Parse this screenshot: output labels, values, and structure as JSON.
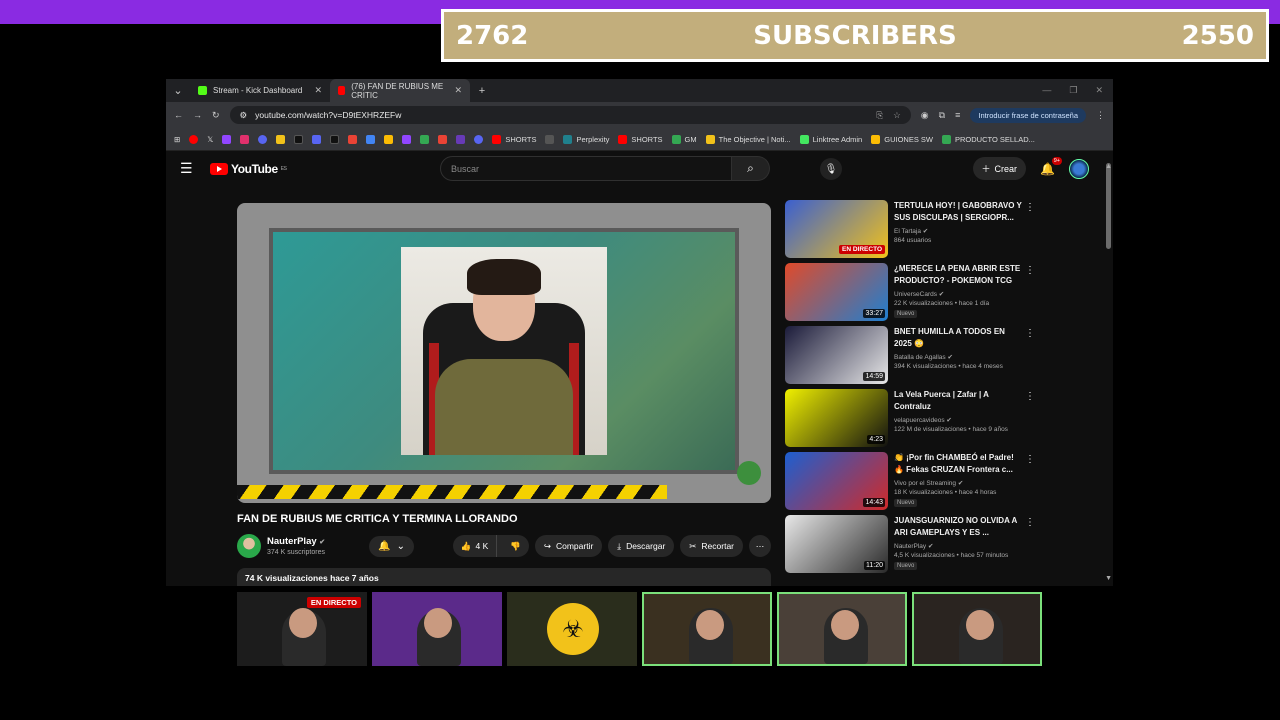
{
  "overlay": {
    "left_count": "2762",
    "label": "SUBSCRIBERS",
    "right_count": "2550"
  },
  "browser": {
    "tabs": [
      {
        "title": "Stream - Kick Dashboard",
        "icon": "kick-icon"
      },
      {
        "title": "(76) FAN DE RUBIUS ME CRITIC",
        "icon": "youtube-icon"
      }
    ],
    "url": "youtube.com/watch?v=D9tEXHRZEFw",
    "password_pill": "Introducir frase de contraseña",
    "bookmarks": [
      "SHORTS",
      "Perplexity",
      "SHORTS",
      "GM",
      "The Objective | Noti...",
      "Linktree Admin",
      "GUIONES SW",
      "PRODUCTO SELLAD..."
    ]
  },
  "youtube": {
    "logo_text": "YouTube",
    "logo_region": "ES",
    "search_placeholder": "Buscar",
    "create_label": "Crear",
    "notif_badge": "9+",
    "video": {
      "title": "FAN DE RUBIUS ME CRITICA Y TERMINA LLORANDO",
      "channel": "NauterPlay",
      "subscribers": "374 K suscriptores",
      "likes": "4 K",
      "share": "Compartir",
      "download": "Descargar",
      "clip": "Recortar",
      "views": "74 K visualizaciones",
      "age": "hace 7 años"
    },
    "recommendations": [
      {
        "title": "TERTULIA HOY! | GABOBRAVO Y SUS DISCULPAS | SERGIOPR...",
        "channel": "El Tartaja",
        "meta": "864 usuarios",
        "badge_live": "EN DIRECTO",
        "duration": "",
        "new": "",
        "colors": [
          "#3a5fd0",
          "#f2c21a"
        ]
      },
      {
        "title": "¿MERECE LA PENA ABRIR ESTE PRODUCTO? - POKEMON TCG",
        "channel": "UniverseCards",
        "meta": "22 K visualizaciones • hace 1 día",
        "badge_live": "",
        "duration": "33:27",
        "new": "Nuevo",
        "colors": [
          "#e04a2a",
          "#1f7fd0"
        ]
      },
      {
        "title": "BNET HUMILLA A TODOS EN 2025 😳",
        "channel": "Batalla de Agallas",
        "meta": "394 K visualizaciones • hace 4 meses",
        "badge_live": "",
        "duration": "14:59",
        "new": "",
        "colors": [
          "#1b1b3a",
          "#e8e8e8"
        ]
      },
      {
        "title": "La Vela Puerca | Zafar | A Contraluz",
        "channel": "velapuercavideos",
        "meta": "122 M de visualizaciones • hace 9 años",
        "badge_live": "",
        "duration": "4:23",
        "new": "",
        "colors": [
          "#f0f000",
          "#111111"
        ]
      },
      {
        "title": "👏 ¡Por fin CHAMBEÓ el Padre! 🔥 Fekas CRUZAN Frontera c...",
        "channel": "Vivo por el Streaming",
        "meta": "18 K visualizaciones • hace 4 horas",
        "badge_live": "",
        "duration": "14:43",
        "new": "Nuevo",
        "colors": [
          "#1d5fd0",
          "#d02a2a"
        ]
      },
      {
        "title": "JUANSGUARNIZO NO OLVIDA A ARI GAMEPLAYS Y ES ...",
        "channel": "NauterPlay",
        "meta": "4,5 K visualizaciones • hace 57 minutos",
        "badge_live": "",
        "duration": "11:20",
        "new": "Nuevo",
        "colors": [
          "#e8e8e8",
          "#2a2a2a"
        ]
      }
    ]
  },
  "webcams": [
    {
      "label": "EN DIRECTO",
      "bg": "#1c1c1c"
    },
    {
      "label": "",
      "bg": "#5b2a8a"
    },
    {
      "label": "",
      "bg": "#2a2d1c"
    },
    {
      "label": "",
      "bg": "#3a3020"
    },
    {
      "label": "",
      "bg": "#4a4038"
    },
    {
      "label": "",
      "bg": "#2a2420"
    }
  ]
}
